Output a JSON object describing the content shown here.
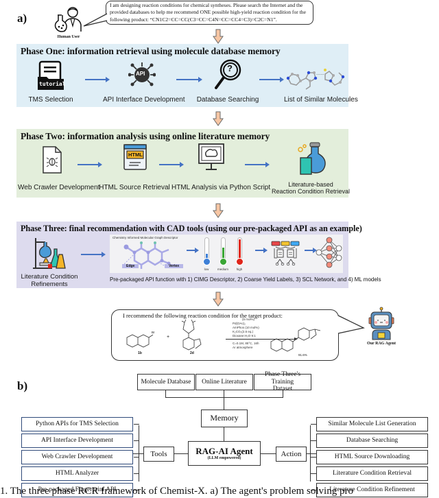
{
  "panel_a": {
    "label": "a)",
    "user": {
      "label": "Human User",
      "prompt": "I am designing reaction conditions for chemical syntheses. Please search the Internet and the provided databases to help me recommend ONE possible high-yield reaction condition for the following product: “CN1C2=CC=CC(C3=CC=C4N=CC=CC4=C3)=C2C=N1”."
    },
    "phase_one": {
      "title": "Phase One: information retrieval using molecule database memory",
      "bg_color": "#dfeef6",
      "steps": [
        {
          "label": "TMS Selection",
          "icon": "tutorial-folder-icon",
          "icon_text": "tutorial"
        },
        {
          "label": "API Interface Development",
          "icon": "api-icon",
          "icon_text": "API"
        },
        {
          "label": "Database Searching",
          "icon": "magnifier-question-icon",
          "icon_text": "?"
        },
        {
          "label": "List of Similar Molecules",
          "icon": "molecules-icon",
          "icon_text": "......"
        }
      ]
    },
    "phase_two": {
      "title": "Phase Two: information analysis using online literature memory",
      "bg_color": "#e3eedb",
      "steps": [
        {
          "label": "Web Crawler Development",
          "icon": "bug-document-icon"
        },
        {
          "label": "HTML Source Retrieval",
          "icon": "html-window-icon",
          "icon_text": "HTML"
        },
        {
          "label": "HTML Analysis via Python Script",
          "icon": "monitor-brain-icon"
        },
        {
          "label_line1": "Literature-based",
          "label_line2": "Reaction Condition Retrieval",
          "icon": "flask-beaker-icon"
        }
      ]
    },
    "phase_three": {
      "title": "Phase Three: final recommendation with CAD tools (using our pre-packaged API as an example)",
      "bg_color": "#dddbee",
      "left_step": {
        "label_line1": "Literature Condition",
        "label_line2": "Refinements",
        "icon": "lab-apparatus-icon"
      },
      "cimg_title": "Chemistry Informed Molecular Graph Descriptor",
      "edge_label": "Edge",
      "vertex_label": "Vertex",
      "thermometers": [
        {
          "label": "low",
          "color": "#3d7fd6",
          "level": 0.25
        },
        {
          "label": "medium",
          "color": "#3aa635",
          "level": 0.55
        },
        {
          "label": "high",
          "color": "#e0261b",
          "level": 0.95
        }
      ],
      "scl_colors": [
        "#e8474a",
        "#f4c430",
        "#3fa9f5"
      ],
      "network_node_color": "#f28b7a",
      "api_caption": "Pre-packaged API function with 1) CIMG Descriptor, 2) Coarse Yield Labels, 3) SCL Network, and 4) ML models"
    },
    "recommendation": {
      "intro": "I recommend the following reaction condition for the target product:",
      "reactant1_label": "1b",
      "reactant1_substituent": "Br",
      "reactant2_label": "2d",
      "plus": "+",
      "conditions_above": [
        "(5 mol%)",
        "Pd(OAc)₂",
        "AmPhos (10 mol%)",
        "K₂CO₃(2.5 eq.)",
        "Dioxane:H₂O 9:1"
      ],
      "conditions_below": [
        "C=0.1M, 85°C, 16h",
        "Ar atmosphere"
      ],
      "product_yield": "91.6%",
      "agent_label": "Our RAG Agent"
    }
  },
  "panel_b": {
    "label": "b)",
    "memory_sources": [
      "Molecule Database",
      "Online Literature",
      "Phase Three's Training Dataset"
    ],
    "memory": "Memory",
    "agent_title": "RAG-AI Agent",
    "agent_subtitle": "(LLM empowered)",
    "tools_label": "Tools",
    "tools": [
      "Python APIs for TMS Selection",
      "API Interface Development",
      "Web Crawler Development",
      "HTML Analyzer",
      "Pre-packaged Fingerprint API"
    ],
    "action_label": "Action",
    "actions": [
      "Similar Molecule List Generation",
      "Database Searching",
      "HTML Source Downloading",
      "Literature Condition Retrieval",
      "Literature Condition Refinement"
    ]
  },
  "caption": "1. The three phase RCR framework of Chemist-X. a) The agent's problem solving pro"
}
